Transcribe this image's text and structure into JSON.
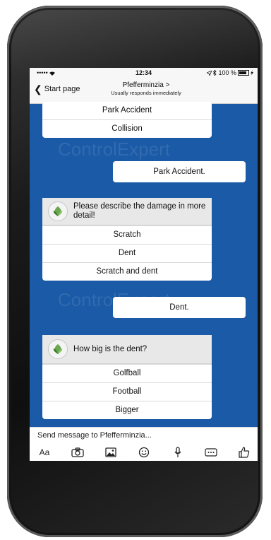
{
  "status_bar": {
    "signal": "••••• ",
    "time": "12:34",
    "battery": "100 %"
  },
  "nav": {
    "back_label": "Start page",
    "contact_name": "Pfefferminzia >",
    "contact_subtitle": "Usually responds immediately"
  },
  "watermark": "ControlExpert",
  "messages": {
    "options_top": [
      "Park Accident",
      "Collision"
    ],
    "reply_1": "Park Accident.",
    "question_2": "Please describe the damage in more detail!",
    "options_2": [
      "Scratch",
      "Dent",
      "Scratch and dent"
    ],
    "reply_2": "Dent.",
    "question_3": "How big is the dent?",
    "options_3": [
      "Golfball",
      "Football",
      "Bigger"
    ]
  },
  "composer": {
    "placeholder": "Send message to Pfefferminzia...",
    "text_format_label": "Aa"
  },
  "colors": {
    "chat_background": "#1a5aa6",
    "bubble": "#ffffff",
    "bot_header": "#e8e8e8",
    "phone_frame": "#1b1b1b"
  }
}
